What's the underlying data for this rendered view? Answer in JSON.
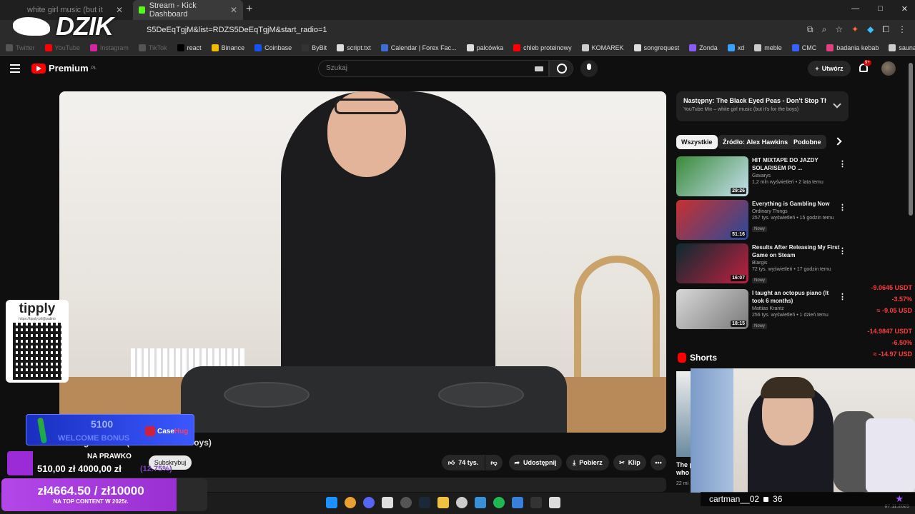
{
  "browser": {
    "tabs": [
      {
        "label": "white girl music (but it",
        "state": "inactive"
      },
      {
        "label": "Stream - Kick Dashboard",
        "state": "active"
      }
    ],
    "new_tab": "+",
    "url": "S5DeEqTgjM&list=RDZS5DeEqTgjM&start_radio=1",
    "window_controls": [
      "—",
      "□",
      "✕"
    ],
    "bookmarks": [
      {
        "label": "Twitter",
        "color": "#555",
        "dim": true
      },
      {
        "label": "YouTube",
        "color": "#ff0000",
        "dim": true
      },
      {
        "label": "Instagram",
        "color": "#d6249f",
        "dim": true
      },
      {
        "label": "TikTok",
        "color": "#555",
        "dim": true
      },
      {
        "label": "react",
        "color": "#000"
      },
      {
        "label": "Binance",
        "color": "#f0b90b"
      },
      {
        "label": "Coinbase",
        "color": "#1652f0"
      },
      {
        "label": "ByBit",
        "color": "#333"
      },
      {
        "label": "script.txt",
        "color": "#ddd"
      },
      {
        "label": "Calendar | Forex Fac...",
        "color": "#3a6fd8"
      },
      {
        "label": "palcówka",
        "color": "#ddd"
      },
      {
        "label": "chleb proteinowy",
        "color": "#ff0000"
      },
      {
        "label": "KOMAREK",
        "color": "#ccc"
      },
      {
        "label": "songrequest",
        "color": "#ddd"
      },
      {
        "label": "Zonda",
        "color": "#8a5cf6"
      },
      {
        "label": "xd",
        "color": "#3aa0ff"
      },
      {
        "label": "meble",
        "color": "#ccc"
      },
      {
        "label": "CMC",
        "color": "#3861fb"
      },
      {
        "label": "badania kebab",
        "color": "#e04080"
      },
      {
        "label": "sauna",
        "color": "#ccc"
      },
      {
        "label": "prawo jazdy",
        "color": "#ccc"
      }
    ]
  },
  "stream_logo": "DZIK",
  "youtube": {
    "logo_text": "Premium",
    "logo_region": "PL",
    "search_placeholder": "Szukaj",
    "create_label": "Utwórz",
    "notifications_badge": "9+",
    "video_title": "white girl music (but it's for the boys)",
    "actions": {
      "likes": "74 tys.",
      "share": "Udostępnij",
      "download": "Pobierz",
      "clip": "Klip",
      "more": "•••"
    },
    "subscribe_label": "Subskrybuj",
    "up_next": {
      "title": "Następny: The Black Eyed Peas - Don't Stop The Pa...",
      "subtitle": "YouTube Mix – white girl music (but it's for the boys)"
    },
    "chips": [
      "Wszystkie",
      "Źródło: Alex Hawkins",
      "Podobne"
    ],
    "recommendations": [
      {
        "title": "HIT MIXTAPE DO JAZDY SOLARISEM PO ...",
        "channel": "Gavarys",
        "meta": "1,2 mln wyświetleń • 2 lata temu",
        "duration": "29:26",
        "badge": "",
        "thumb": "linear-gradient(135deg,#3a8a3a,#c7e0f0)"
      },
      {
        "title": "Everything is Gambling Now",
        "channel": "Ordinary Things",
        "meta": "257 tys. wyświetleń • 15 godzin temu",
        "duration": "51:16",
        "badge": "Nowy",
        "thumb": "linear-gradient(135deg,#c83030,#2a4a9a)"
      },
      {
        "title": "Results After Releasing My First Game on Steam",
        "channel": "Blargis",
        "meta": "72 tys. wyświetleń • 17 godzin temu",
        "duration": "16:07",
        "badge": "Nowy",
        "thumb": "linear-gradient(135deg,#0a2a30,#c02040)"
      },
      {
        "title": "I taught an octopus piano (It took 6 months)",
        "channel": "Mattias Krantz",
        "meta": "256 tys. wyświetleń • 1 dzień temu",
        "duration": "18:15",
        "badge": "Nowy",
        "thumb": "linear-gradient(135deg,#d8d8d8,#7a7a7a)"
      }
    ],
    "shorts_label": "Shorts",
    "short_text": "The p who",
    "short_meta": "22 mi"
  },
  "stocks": [
    {
      "value": "-9.0645 USDT",
      "pct": "-3.57%",
      "approx": "≈ -9.05 USD"
    },
    {
      "value": "-14.9847 USDT",
      "pct": "-6.50%",
      "approx": "≈ -14.97 USD"
    }
  ],
  "tipply": {
    "logo": "tipply",
    "url": "https://tipply.pl/@patino"
  },
  "casehug": {
    "amount": "5100",
    "bonus": "WELCOME BONUS",
    "brand_a": "Case",
    "brand_b": "Hug"
  },
  "goal1": {
    "title": "NA PRAWKO",
    "amount": "510,00 zł   4000,00 zł",
    "percent": "(12.75%)"
  },
  "goal2": {
    "amount": "zł4664.50 / zł10000",
    "subtitle": "NA TOP CONTENT W 2025r."
  },
  "webcam": {
    "username": "cartman__02",
    "count": "36"
  },
  "clock": "07.11.2025"
}
